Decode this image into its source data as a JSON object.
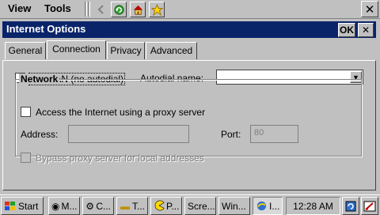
{
  "menubar": {
    "view": "View",
    "tools": "Tools"
  },
  "toolbar": {
    "back_icon": "back-arrow-icon",
    "refresh_icon": "refresh-icon",
    "home_icon": "home-icon",
    "favorites_icon": "favorites-star-icon",
    "close": "✕"
  },
  "dialog": {
    "title": "Internet Options",
    "ok": "OK",
    "close": "✕",
    "tabs": [
      {
        "label": "General",
        "active": false
      },
      {
        "label": "Connection",
        "active": true
      },
      {
        "label": "Privacy",
        "active": false
      },
      {
        "label": "Advanced",
        "active": false
      }
    ],
    "use_lan": {
      "label": "Use LAN (no autodial)",
      "checked": false
    },
    "autodial": {
      "label": "Autodial name:",
      "value": ""
    },
    "network": {
      "title": "Network",
      "proxy": {
        "label": "Access the Internet using a proxy server",
        "checked": false
      },
      "address": {
        "label": "Address:",
        "value": ""
      },
      "port": {
        "label": "Port:",
        "value": "80"
      },
      "bypass": {
        "label": "Bypass proxy server for local addresses",
        "checked": false,
        "enabled": false
      }
    }
  },
  "taskbar": {
    "start": "Start",
    "items": [
      {
        "label": "M...",
        "icon": "media-icon"
      },
      {
        "label": "C...",
        "icon": "control-panel-icon"
      },
      {
        "label": "T...",
        "icon": "folder-icon"
      },
      {
        "label": "P...",
        "icon": "pacman-icon"
      },
      {
        "label": "Scre...",
        "icon": ""
      },
      {
        "label": "Win...",
        "icon": ""
      },
      {
        "label": "I...",
        "icon": "internet-explorer-icon",
        "active": true
      }
    ],
    "clock": "12:28 AM"
  }
}
